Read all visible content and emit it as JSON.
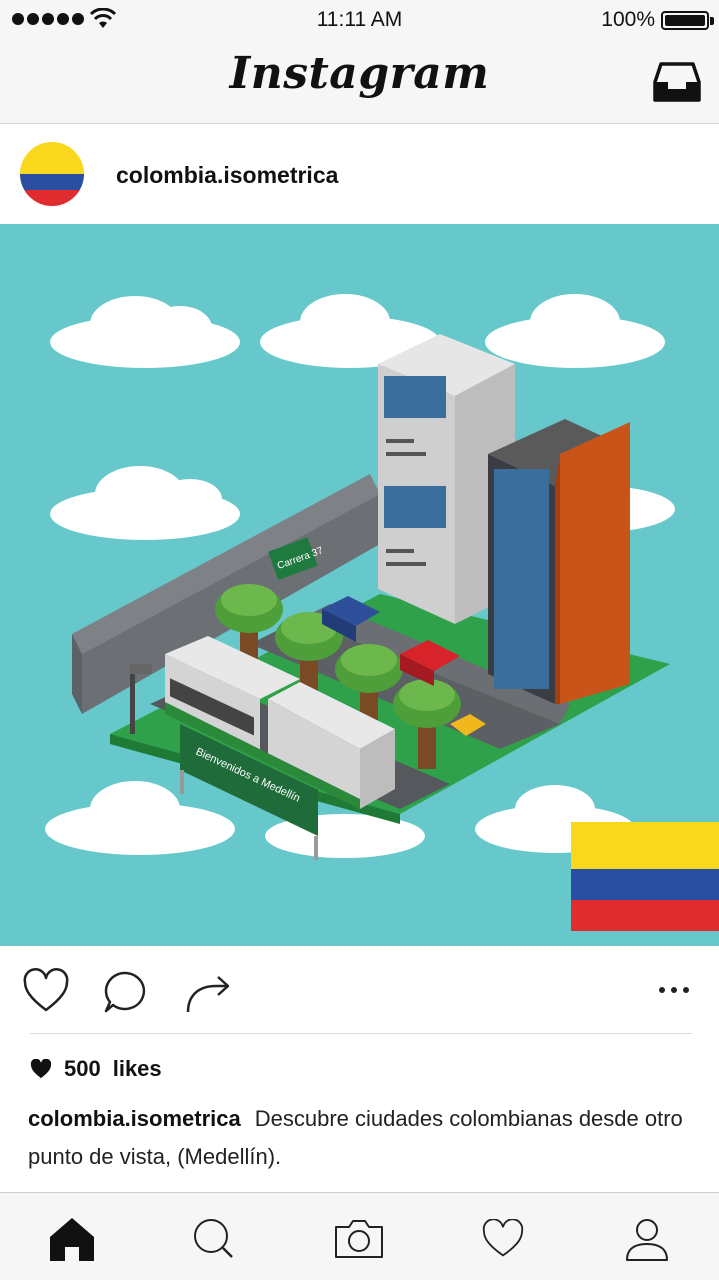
{
  "status_bar": {
    "time": "11:11 AM",
    "battery": "100%"
  },
  "header": {
    "app_title": "Instagram",
    "inbox_icon": "inbox-tray-icon"
  },
  "post": {
    "username": "colombia.isometrica",
    "avatar": "colombia-flag",
    "image": {
      "street_sign": "Carrera 37",
      "welcome_sign": "Bienvenidos a Medellín",
      "flag_colors": [
        "#f9d71c",
        "#2a4ea2",
        "#e02b2f"
      ]
    },
    "likes_count": "500",
    "likes_label": "likes",
    "caption_user": "colombia.isometrica",
    "caption_text": "Descubre ciudades colombianas desde otro punto de vista, (Medellín)."
  },
  "actions": [
    "heart-icon",
    "comment-icon",
    "share-icon",
    "more-icon"
  ],
  "nav": [
    "home-icon",
    "search-icon",
    "camera-icon",
    "heart-icon",
    "profile-icon"
  ]
}
